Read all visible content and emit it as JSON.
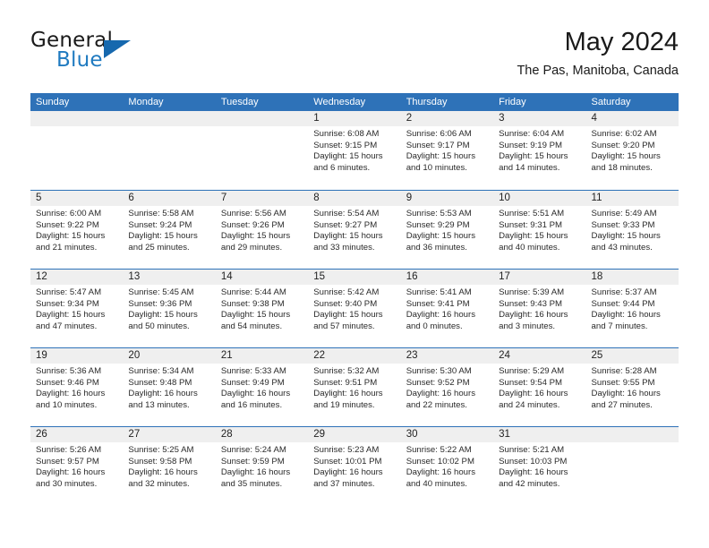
{
  "brand": {
    "name_part1": "General",
    "name_part2": "Blue",
    "triangle_color": "#1668ae",
    "blue_color": "#1f7ac0"
  },
  "header": {
    "title": "May 2024",
    "location": "The Pas, Manitoba, Canada"
  },
  "theme": {
    "header_blue": "#2e72b8",
    "day_band_gray": "#efefef",
    "text_color": "#222222"
  },
  "weekdays": [
    "Sunday",
    "Monday",
    "Tuesday",
    "Wednesday",
    "Thursday",
    "Friday",
    "Saturday"
  ],
  "weeks": [
    [
      {
        "day": "",
        "lines": []
      },
      {
        "day": "",
        "lines": []
      },
      {
        "day": "",
        "lines": []
      },
      {
        "day": "1",
        "lines": [
          "Sunrise: 6:08 AM",
          "Sunset: 9:15 PM",
          "Daylight: 15 hours",
          "and 6 minutes."
        ]
      },
      {
        "day": "2",
        "lines": [
          "Sunrise: 6:06 AM",
          "Sunset: 9:17 PM",
          "Daylight: 15 hours",
          "and 10 minutes."
        ]
      },
      {
        "day": "3",
        "lines": [
          "Sunrise: 6:04 AM",
          "Sunset: 9:19 PM",
          "Daylight: 15 hours",
          "and 14 minutes."
        ]
      },
      {
        "day": "4",
        "lines": [
          "Sunrise: 6:02 AM",
          "Sunset: 9:20 PM",
          "Daylight: 15 hours",
          "and 18 minutes."
        ]
      }
    ],
    [
      {
        "day": "5",
        "lines": [
          "Sunrise: 6:00 AM",
          "Sunset: 9:22 PM",
          "Daylight: 15 hours",
          "and 21 minutes."
        ]
      },
      {
        "day": "6",
        "lines": [
          "Sunrise: 5:58 AM",
          "Sunset: 9:24 PM",
          "Daylight: 15 hours",
          "and 25 minutes."
        ]
      },
      {
        "day": "7",
        "lines": [
          "Sunrise: 5:56 AM",
          "Sunset: 9:26 PM",
          "Daylight: 15 hours",
          "and 29 minutes."
        ]
      },
      {
        "day": "8",
        "lines": [
          "Sunrise: 5:54 AM",
          "Sunset: 9:27 PM",
          "Daylight: 15 hours",
          "and 33 minutes."
        ]
      },
      {
        "day": "9",
        "lines": [
          "Sunrise: 5:53 AM",
          "Sunset: 9:29 PM",
          "Daylight: 15 hours",
          "and 36 minutes."
        ]
      },
      {
        "day": "10",
        "lines": [
          "Sunrise: 5:51 AM",
          "Sunset: 9:31 PM",
          "Daylight: 15 hours",
          "and 40 minutes."
        ]
      },
      {
        "day": "11",
        "lines": [
          "Sunrise: 5:49 AM",
          "Sunset: 9:33 PM",
          "Daylight: 15 hours",
          "and 43 minutes."
        ]
      }
    ],
    [
      {
        "day": "12",
        "lines": [
          "Sunrise: 5:47 AM",
          "Sunset: 9:34 PM",
          "Daylight: 15 hours",
          "and 47 minutes."
        ]
      },
      {
        "day": "13",
        "lines": [
          "Sunrise: 5:45 AM",
          "Sunset: 9:36 PM",
          "Daylight: 15 hours",
          "and 50 minutes."
        ]
      },
      {
        "day": "14",
        "lines": [
          "Sunrise: 5:44 AM",
          "Sunset: 9:38 PM",
          "Daylight: 15 hours",
          "and 54 minutes."
        ]
      },
      {
        "day": "15",
        "lines": [
          "Sunrise: 5:42 AM",
          "Sunset: 9:40 PM",
          "Daylight: 15 hours",
          "and 57 minutes."
        ]
      },
      {
        "day": "16",
        "lines": [
          "Sunrise: 5:41 AM",
          "Sunset: 9:41 PM",
          "Daylight: 16 hours",
          "and 0 minutes."
        ]
      },
      {
        "day": "17",
        "lines": [
          "Sunrise: 5:39 AM",
          "Sunset: 9:43 PM",
          "Daylight: 16 hours",
          "and 3 minutes."
        ]
      },
      {
        "day": "18",
        "lines": [
          "Sunrise: 5:37 AM",
          "Sunset: 9:44 PM",
          "Daylight: 16 hours",
          "and 7 minutes."
        ]
      }
    ],
    [
      {
        "day": "19",
        "lines": [
          "Sunrise: 5:36 AM",
          "Sunset: 9:46 PM",
          "Daylight: 16 hours",
          "and 10 minutes."
        ]
      },
      {
        "day": "20",
        "lines": [
          "Sunrise: 5:34 AM",
          "Sunset: 9:48 PM",
          "Daylight: 16 hours",
          "and 13 minutes."
        ]
      },
      {
        "day": "21",
        "lines": [
          "Sunrise: 5:33 AM",
          "Sunset: 9:49 PM",
          "Daylight: 16 hours",
          "and 16 minutes."
        ]
      },
      {
        "day": "22",
        "lines": [
          "Sunrise: 5:32 AM",
          "Sunset: 9:51 PM",
          "Daylight: 16 hours",
          "and 19 minutes."
        ]
      },
      {
        "day": "23",
        "lines": [
          "Sunrise: 5:30 AM",
          "Sunset: 9:52 PM",
          "Daylight: 16 hours",
          "and 22 minutes."
        ]
      },
      {
        "day": "24",
        "lines": [
          "Sunrise: 5:29 AM",
          "Sunset: 9:54 PM",
          "Daylight: 16 hours",
          "and 24 minutes."
        ]
      },
      {
        "day": "25",
        "lines": [
          "Sunrise: 5:28 AM",
          "Sunset: 9:55 PM",
          "Daylight: 16 hours",
          "and 27 minutes."
        ]
      }
    ],
    [
      {
        "day": "26",
        "lines": [
          "Sunrise: 5:26 AM",
          "Sunset: 9:57 PM",
          "Daylight: 16 hours",
          "and 30 minutes."
        ]
      },
      {
        "day": "27",
        "lines": [
          "Sunrise: 5:25 AM",
          "Sunset: 9:58 PM",
          "Daylight: 16 hours",
          "and 32 minutes."
        ]
      },
      {
        "day": "28",
        "lines": [
          "Sunrise: 5:24 AM",
          "Sunset: 9:59 PM",
          "Daylight: 16 hours",
          "and 35 minutes."
        ]
      },
      {
        "day": "29",
        "lines": [
          "Sunrise: 5:23 AM",
          "Sunset: 10:01 PM",
          "Daylight: 16 hours",
          "and 37 minutes."
        ]
      },
      {
        "day": "30",
        "lines": [
          "Sunrise: 5:22 AM",
          "Sunset: 10:02 PM",
          "Daylight: 16 hours",
          "and 40 minutes."
        ]
      },
      {
        "day": "31",
        "lines": [
          "Sunrise: 5:21 AM",
          "Sunset: 10:03 PM",
          "Daylight: 16 hours",
          "and 42 minutes."
        ]
      },
      {
        "day": "",
        "lines": []
      }
    ]
  ]
}
